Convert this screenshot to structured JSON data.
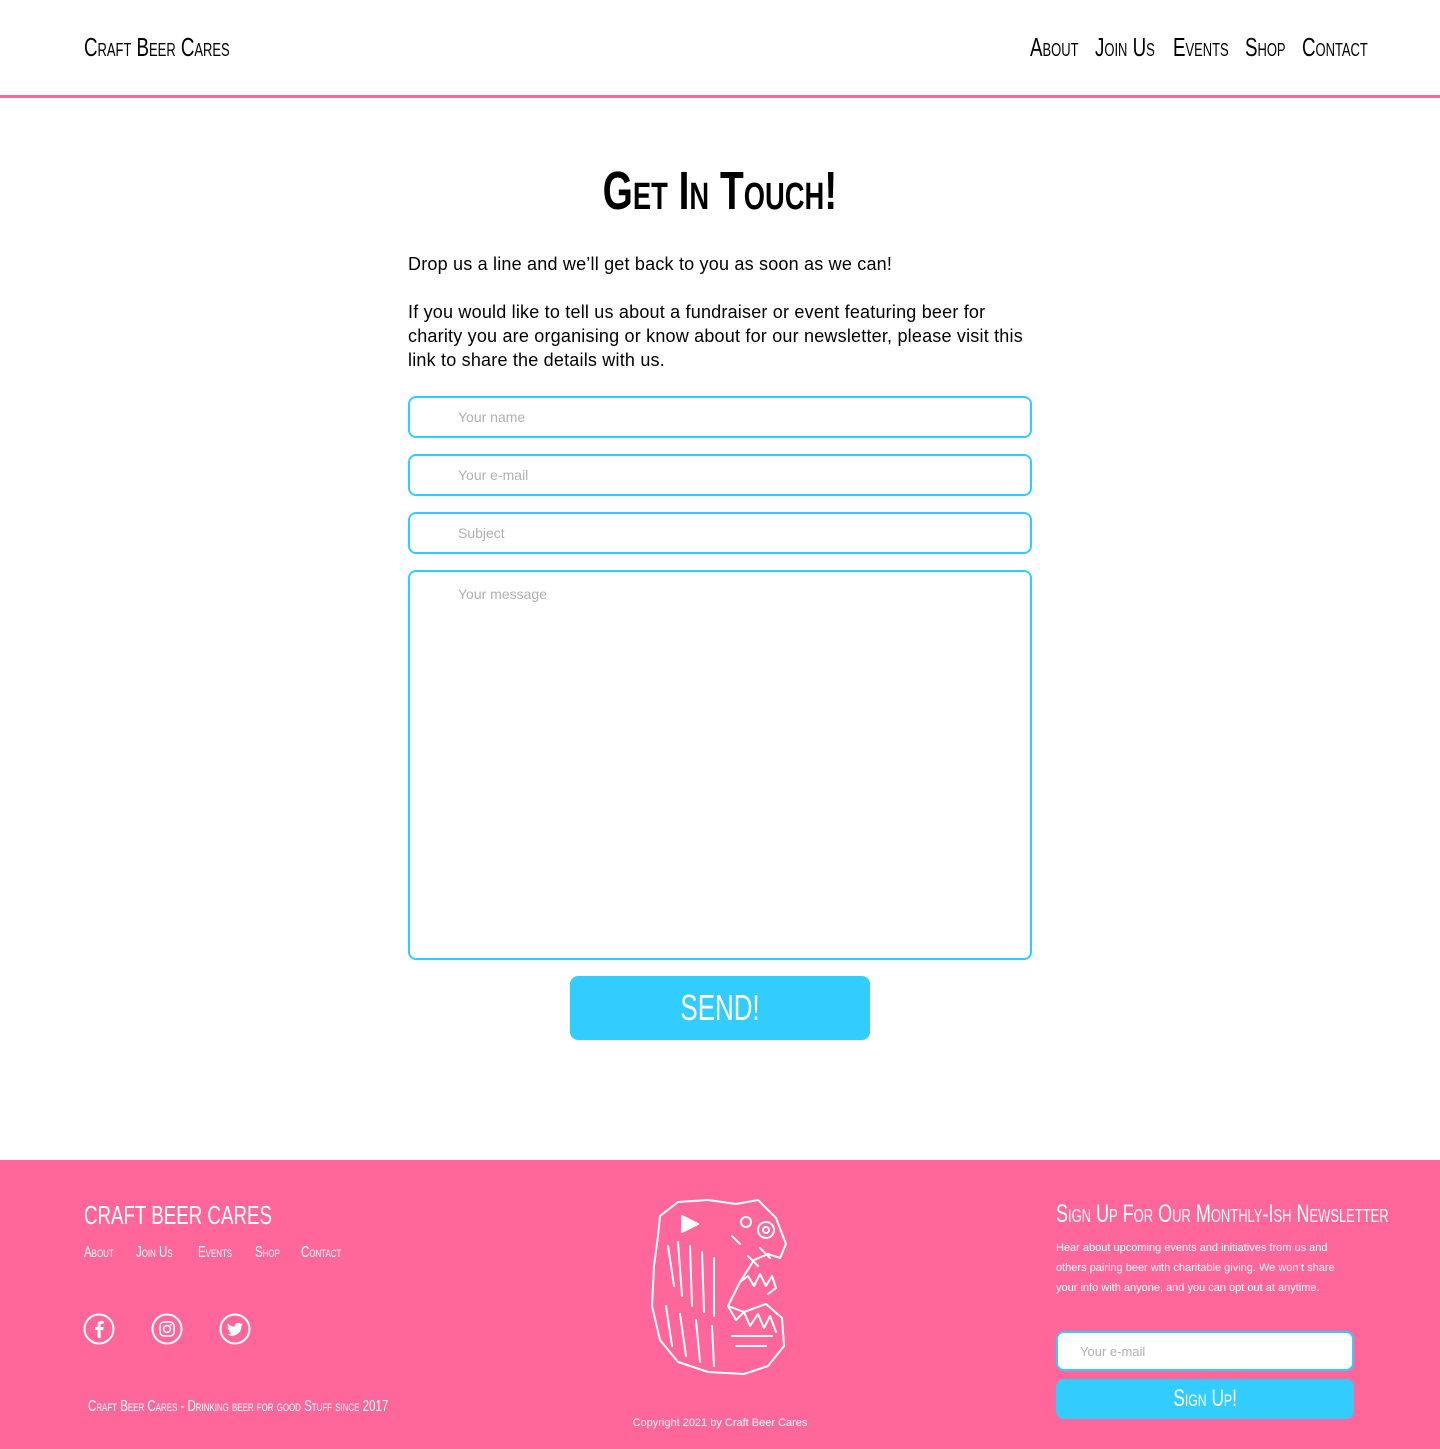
{
  "header": {
    "brand": "Craft Beer Cares",
    "nav": [
      "About",
      "Join Us",
      "Events",
      "Shop",
      "Contact"
    ]
  },
  "main": {
    "title": "Get In Touch!",
    "intro_1": "Drop us a line and we’ll get back to you as soon as we can!",
    "intro_2": "If you would like to tell us about a fundraiser or event featuring beer for charity you are organising or know about for our newsletter, please visit this link to share the details with us.",
    "form": {
      "name_placeholder": "Your name",
      "email_placeholder": "Your e-mail",
      "subject_placeholder": "Subject",
      "message_placeholder": "Your message",
      "send_label": "SEND!"
    }
  },
  "footer": {
    "brand": "Craft Beer Cares",
    "nav": [
      "About",
      "Join Us",
      "Events",
      "Shop",
      "Contact"
    ],
    "social_icons": [
      "facebook-icon",
      "instagram-icon",
      "twitter-icon"
    ],
    "tagline": "Craft Beer Cares - Drinking beer for good Stuff since 2017",
    "copyright": "Copyright 2021 by Craft Beer Cares",
    "newsletter": {
      "title": "Sign Up For Our Monthly-Ish Newsletter",
      "text": "Hear about upcoming events and initiatives from us and others pairing beer with charitable giving. We won’t share your info with anyone, and you can opt out at anytime.",
      "email_placeholder": "Your e-mail",
      "button_label": "Sign Up!"
    }
  },
  "colors": {
    "accent_pink": "#ff6699",
    "accent_blue": "#33ccff"
  }
}
